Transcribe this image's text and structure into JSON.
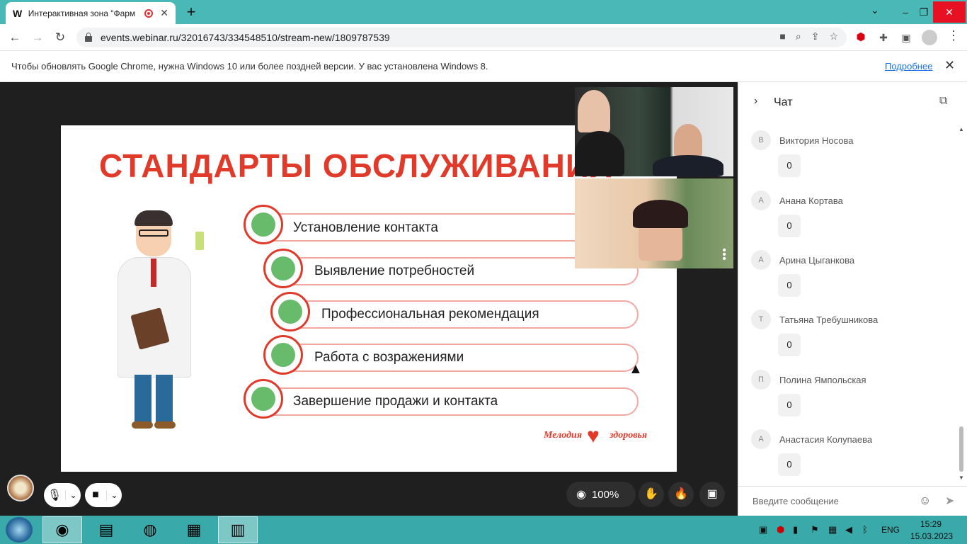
{
  "browser": {
    "tab_favicon": "W",
    "tab_title": "Интерактивная зона \"Фарм",
    "new_tab": "+",
    "url": "events.webinar.ru/32016743/334548510/stream-new/1809787539",
    "window_minimize": "–",
    "window_restore": "❐",
    "window_close": "✕"
  },
  "infobar": {
    "message": "Чтобы обновлять Google Chrome, нужна Windows 10 или более поздней версии. У вас установлена Windows 8.",
    "link": "Подробнее",
    "close": "✕"
  },
  "slide": {
    "title": "СТАНДАРТЫ ОБСЛУЖИВАНИЯ",
    "steps": [
      "Установление контакта",
      "Выявление потребностей",
      "Профессиональная рекомендация",
      "Работа с возражениями",
      "Завершение продажи и контакта"
    ],
    "logo_left": "Мелодия",
    "logo_right": "здоровья"
  },
  "controls": {
    "zoom": "100%"
  },
  "chat": {
    "title": "Чат",
    "messages": [
      {
        "initial": "В",
        "name": "Виктория Носова",
        "text": "0"
      },
      {
        "initial": "А",
        "name": "Анана Кортава",
        "text": "0"
      },
      {
        "initial": "А",
        "name": "Арина Цыганкова",
        "text": "0"
      },
      {
        "initial": "Т",
        "name": "Татьяна Требушникова",
        "text": "0"
      },
      {
        "initial": "П",
        "name": "Полина Ямпольская",
        "text": "0"
      },
      {
        "initial": "А",
        "name": "Анастасия Колупаева",
        "text": "0"
      }
    ],
    "input_placeholder": "Введите сообщение"
  },
  "taskbar": {
    "language": "ENG",
    "time": "15:29",
    "date": "15.03.2023"
  },
  "colors": {
    "accent_teal": "#4bb8b8",
    "slide_red": "#e03a2a",
    "step_green": "#4caf50"
  }
}
